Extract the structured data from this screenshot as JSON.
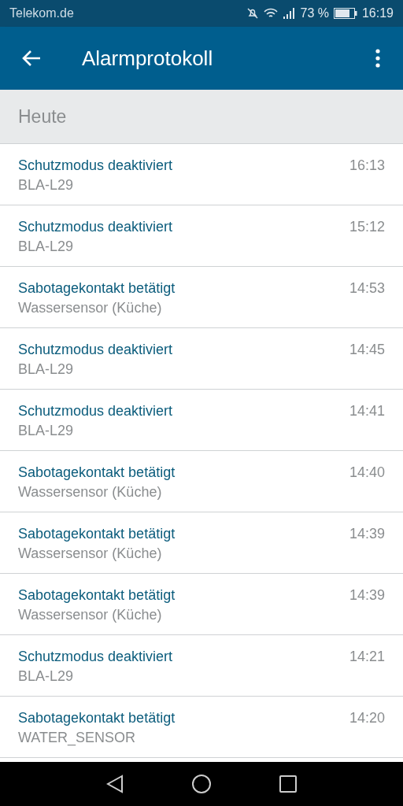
{
  "status_bar": {
    "carrier": "Telekom.de",
    "battery_percent": "73 %",
    "time": "16:19"
  },
  "app_bar": {
    "title": "Alarmprotokoll"
  },
  "section": {
    "title": "Heute"
  },
  "events": [
    {
      "title": "Schutzmodus deaktiviert",
      "source": "BLA-L29",
      "time": "16:13"
    },
    {
      "title": "Schutzmodus deaktiviert",
      "source": "BLA-L29",
      "time": "15:12"
    },
    {
      "title": "Sabotagekontakt betätigt",
      "source": "Wassersensor (Küche)",
      "time": "14:53"
    },
    {
      "title": "Schutzmodus deaktiviert",
      "source": "BLA-L29",
      "time": "14:45"
    },
    {
      "title": "Schutzmodus deaktiviert",
      "source": "BLA-L29",
      "time": "14:41"
    },
    {
      "title": "Sabotagekontakt betätigt",
      "source": "Wassersensor (Küche)",
      "time": "14:40"
    },
    {
      "title": "Sabotagekontakt betätigt",
      "source": "Wassersensor (Küche)",
      "time": "14:39"
    },
    {
      "title": "Sabotagekontakt betätigt",
      "source": "Wassersensor (Küche)",
      "time": "14:39"
    },
    {
      "title": "Schutzmodus deaktiviert",
      "source": "BLA-L29",
      "time": "14:21"
    },
    {
      "title": "Sabotagekontakt betätigt",
      "source": "WATER_SENSOR",
      "time": "14:20"
    }
  ]
}
